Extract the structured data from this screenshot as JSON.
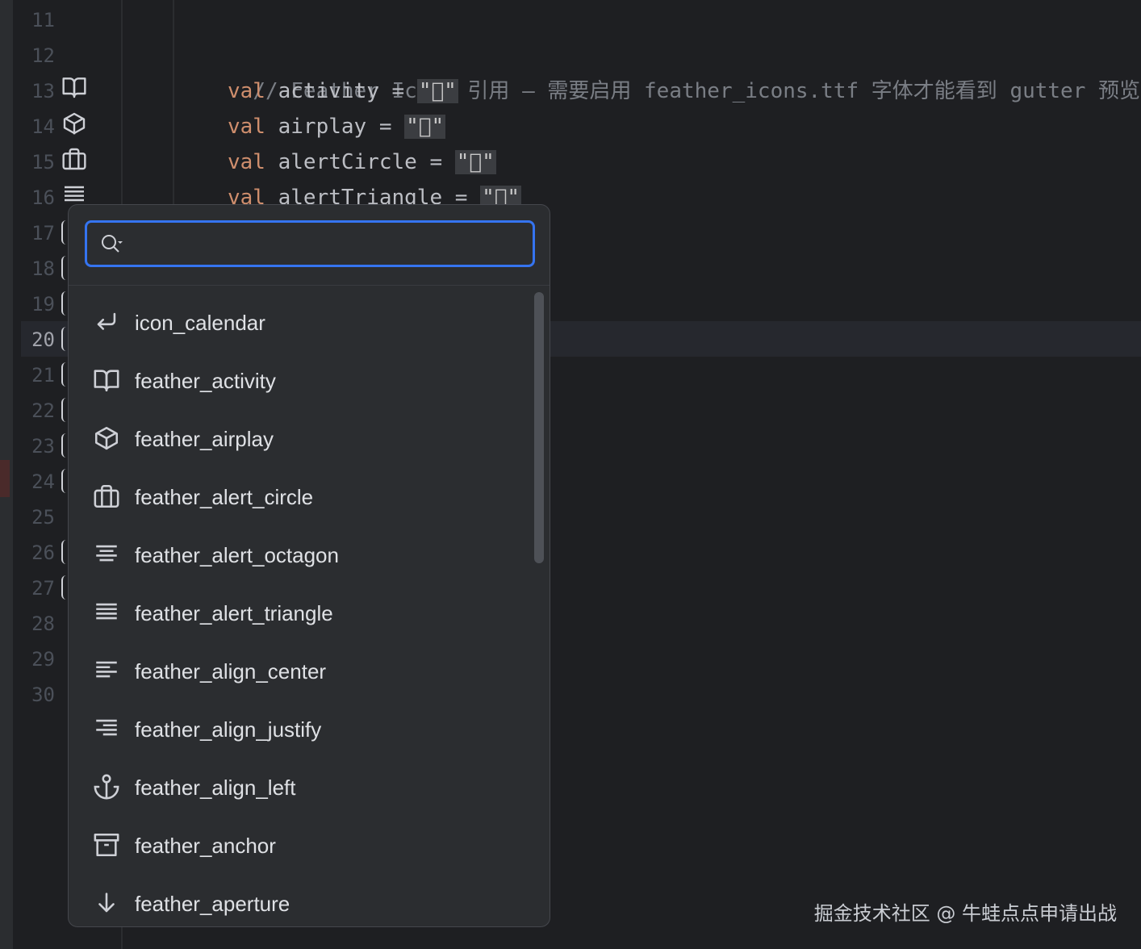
{
  "editor": {
    "line_numbers": [
      "11",
      "12",
      "13",
      "14",
      "15",
      "16",
      "17",
      "18",
      "19",
      "20",
      "21",
      "22",
      "23",
      "24",
      "25",
      "26",
      "27",
      "28",
      "29",
      "30"
    ],
    "current_line": "20",
    "gutter_icons": [
      "book-open-icon",
      "box-icon",
      "briefcase-icon",
      "align-justify-icon"
    ],
    "code": {
      "comment": "// Feather Icons 引用 — 需要启用 feather_icons.ttf 字体才能看到 gutter 预览",
      "lines": [
        {
          "kw": "val",
          "name": " activity = ",
          "str": "\"\""
        },
        {
          "kw": "val",
          "name": " airplay = ",
          "str": "\"\""
        },
        {
          "kw": "val",
          "name": " alertCircle = ",
          "str": "\"\""
        },
        {
          "kw": "val",
          "name": " alertTriangle = ",
          "str": "\"\""
        }
      ]
    }
  },
  "popup": {
    "search": {
      "value": "",
      "placeholder": ""
    },
    "items": [
      {
        "label": "icon_calendar",
        "icon": "return-arrow-icon"
      },
      {
        "label": "feather_activity",
        "icon": "book-open-icon"
      },
      {
        "label": "feather_airplay",
        "icon": "box-icon"
      },
      {
        "label": "feather_alert_circle",
        "icon": "briefcase-icon"
      },
      {
        "label": "feather_alert_octagon",
        "icon": "align-center-icon"
      },
      {
        "label": "feather_alert_triangle",
        "icon": "align-justify-icon"
      },
      {
        "label": "feather_align_center",
        "icon": "align-left-icon"
      },
      {
        "label": "feather_align_justify",
        "icon": "align-right-icon"
      },
      {
        "label": "feather_align_left",
        "icon": "anchor-icon"
      },
      {
        "label": "feather_anchor",
        "icon": "archive-icon"
      },
      {
        "label": "feather_aperture",
        "icon": "arrow-down-icon"
      }
    ]
  },
  "watermark": "掘金技术社区 @ 牛蛙点点申请出战",
  "colors": {
    "accent": "#3574f0",
    "keyword": "#cf8e6d",
    "background": "#1e1f22",
    "popup": "#2b2d30"
  }
}
